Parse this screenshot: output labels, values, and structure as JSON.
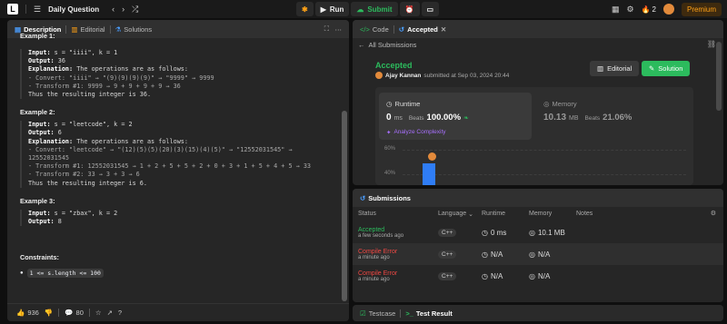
{
  "topbar": {
    "logo_icon": "leetcode-logo-icon",
    "title": "Daily Question",
    "run_label": "Run",
    "submit_label": "Submit",
    "streak_count": "2",
    "premium_label": "Premium"
  },
  "left_panel": {
    "tabs": [
      {
        "label": "Description",
        "icon": "file-icon"
      },
      {
        "label": "Editorial",
        "icon": "book-icon"
      },
      {
        "label": "Solutions",
        "icon": "flask-icon"
      }
    ],
    "example1": {
      "partial_heading": "Example 1:",
      "input_label": "Input:",
      "input_value": "s = \"iiii\", k = 1",
      "output_label": "Output:",
      "output_value": "36",
      "explanation_label": "Explanation:",
      "explanation_text": "The operations are as follows:",
      "lines": [
        "- Convert: \"iiii\" → \"(9)(9)(9)(9)\" → \"9999\" → 9999",
        "- Transform #1: 9999 → 9 + 9 + 9 + 9 → 36",
        "Thus the resulting integer is 36."
      ]
    },
    "example2": {
      "heading": "Example 2:",
      "input_label": "Input:",
      "input_value": "s = \"leetcode\", k = 2",
      "output_label": "Output:",
      "output_value": "6",
      "explanation_label": "Explanation:",
      "explanation_text": "The operations are as follows:",
      "lines": [
        "- Convert: \"leetcode\" → \"(12)(5)(5)(20)(3)(15)(4)(5)\" → \"12552031545\" →",
        "12552031545",
        "- Transform #1: 12552031545 → 1 + 2 + 5 + 5 + 2 + 0 + 3 + 1 + 5 + 4 + 5 → 33",
        "- Transform #2: 33 → 3 + 3 → 6",
        "Thus the resulting integer is 6."
      ]
    },
    "example3": {
      "heading": "Example 3:",
      "input_label": "Input:",
      "input_value": "s = \"zbax\", k = 2",
      "output_label": "Output:",
      "output_value": "8"
    },
    "constraints_heading": "Constraints:",
    "constraint1": "1 <= s.length <= 100",
    "bottom": {
      "likes": "936",
      "comments": "80"
    }
  },
  "right_top": {
    "tabs": [
      {
        "label": "Code",
        "icon": "code-icon"
      },
      {
        "label": "Accepted",
        "icon": "history-icon"
      }
    ],
    "back_label": "All Submissions",
    "status": "Accepted",
    "author": "Ajay Kannan",
    "submitted_text": "submitted at Sep 03, 2024 20:44",
    "editorial_btn": "Editorial",
    "solution_btn": "Solution",
    "runtime": {
      "label": "Runtime",
      "value": "0",
      "unit": "ms",
      "beats_label": "Beats",
      "beats_value": "100.00%",
      "analyze_label": "Analyze Complexity"
    },
    "memory": {
      "label": "Memory",
      "value": "10.13",
      "unit": "MB",
      "beats_label": "Beats",
      "beats_value": "21.06%"
    },
    "chart_labels": [
      "60%",
      "40%"
    ]
  },
  "submissions": {
    "title": "Submissions",
    "headers": [
      "Status",
      "Language",
      "Runtime",
      "Memory",
      "Notes"
    ],
    "rows": [
      {
        "status": "Accepted",
        "time": "a few seconds ago",
        "lang": "C++",
        "runtime": "0 ms",
        "memory": "10.1 MB",
        "color": "#2cbb5d"
      },
      {
        "status": "Compile Error",
        "time": "a minute ago",
        "lang": "C++",
        "runtime": "N/A",
        "memory": "N/A",
        "color": "#ef4743"
      },
      {
        "status": "Compile Error",
        "time": "a minute ago",
        "lang": "C++",
        "runtime": "N/A",
        "memory": "N/A",
        "color": "#ef4743"
      }
    ]
  },
  "bottom_tabs": {
    "testcase": "Testcase",
    "result": "Test Result"
  },
  "colors": {
    "accent_green": "#2cbb5d",
    "accent_orange": "#ffa116",
    "error_red": "#ef4743",
    "link_blue": "#4a9eff"
  }
}
